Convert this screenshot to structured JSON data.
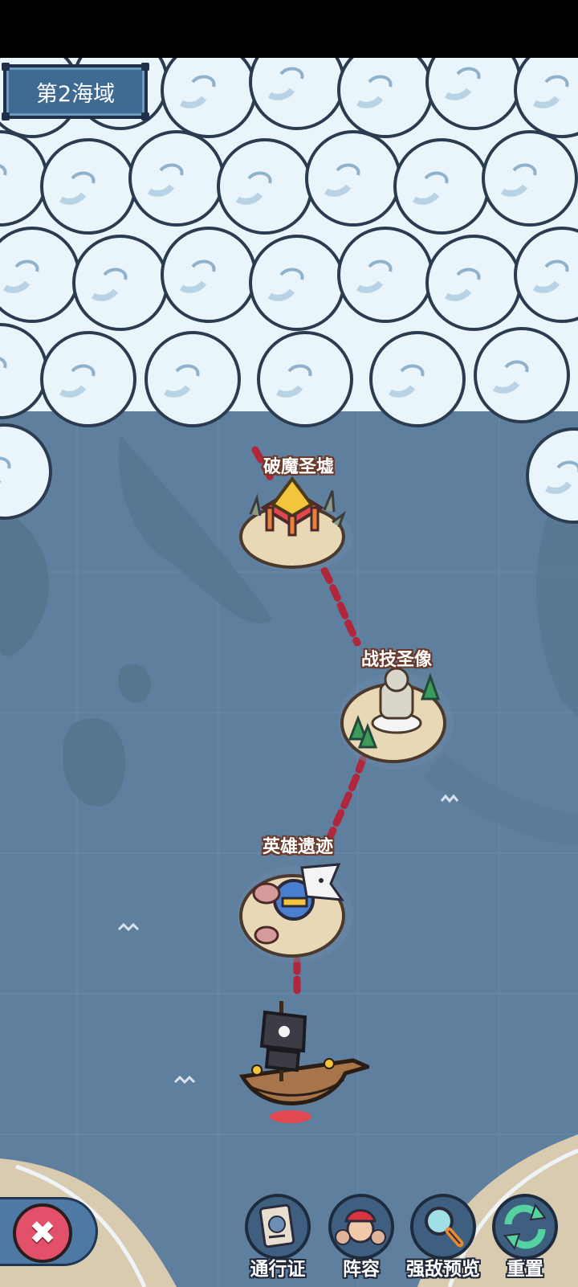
{
  "region": {
    "title": "第2海域"
  },
  "nodes": [
    {
      "id": "boss",
      "label": "破魔圣墟"
    },
    {
      "id": "statue",
      "label": "战技圣像"
    },
    {
      "id": "ruins",
      "label": "英雄遗迹"
    }
  ],
  "bottom_bar": {
    "close_icon": "close-icon",
    "actions": [
      {
        "label": "通行证",
        "icon": "pass-icon"
      },
      {
        "label": "阵容",
        "icon": "lineup-icon"
      },
      {
        "label": "强敌预览",
        "icon": "magnifier-icon"
      },
      {
        "label": "重置",
        "icon": "reset-icon"
      }
    ]
  },
  "colors": {
    "sea": "#5f7f9e",
    "cloud": "#eaf4fb",
    "route": "#b0263a",
    "badge": "#3e6a93",
    "close": "#e3506a"
  }
}
